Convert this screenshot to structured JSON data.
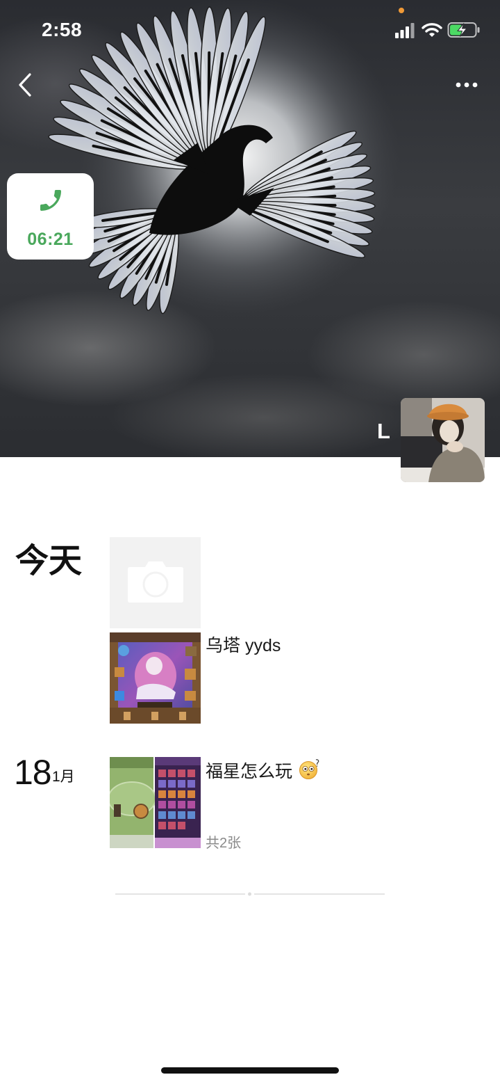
{
  "status_bar": {
    "time": "2:58",
    "icons": [
      "privacy-dot-icon",
      "signal-icon",
      "wifi-icon",
      "battery-charging-icon"
    ]
  },
  "nav": {
    "back_icon": "chevron-left-icon",
    "more_icon": "more-dots-icon"
  },
  "call_widget": {
    "icon": "phone-icon",
    "duration": "06:21"
  },
  "profile": {
    "name": "L"
  },
  "today": {
    "label": "今天",
    "camera_icon": "camera-icon",
    "post": {
      "text": "乌塔 yyds"
    }
  },
  "jan18": {
    "day": "18",
    "month": "1月",
    "post": {
      "text": "福星怎么玩",
      "emoji": "confused-face-emoji",
      "photo_count": "共2张"
    }
  },
  "colors": {
    "accent_green": "#4aa85c",
    "text_primary": "#191919",
    "text_secondary": "#8a8a8a",
    "battery_green": "#4cd964",
    "privacy_dot": "#f09a37"
  }
}
